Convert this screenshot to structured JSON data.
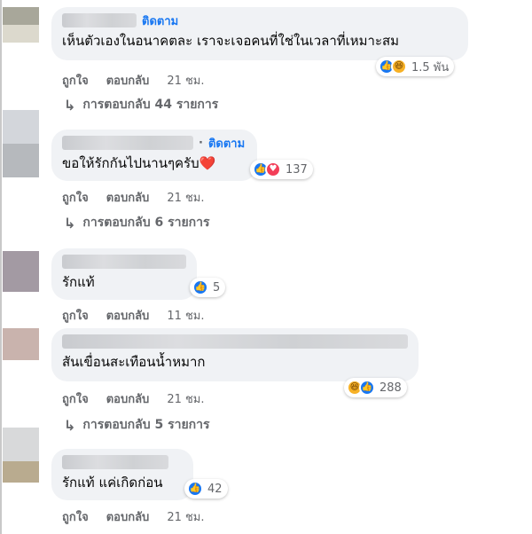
{
  "labels": {
    "follow": "ติดตาม",
    "like": "ถูกใจ",
    "reply": "ตอบกลับ"
  },
  "comments": [
    {
      "follow": true,
      "text": "เห็นตัวเองในอนาคตละ เราจะเจอคนที่ใช่ในเวลาที่เหมาะสม",
      "reactions": [
        "like-icon",
        "haha-icon"
      ],
      "count": "1.5 พัน",
      "time": "21 ชม.",
      "replies": "การตอบกลับ 44 รายการ",
      "avatar_colors": [
        "#a8a79a",
        "#dcd9cd"
      ]
    },
    {
      "follow": true,
      "text": "ขอให้รักกันไปนานๆครับ❤️",
      "reactions": [
        "like-icon",
        "love-icon"
      ],
      "count": "137",
      "time": "21 ชม.",
      "replies": "การตอบกลับ 6 รายการ",
      "avatar_colors": [
        "#c9ccd2",
        "#b6b9bd"
      ]
    },
    {
      "follow": false,
      "text": "รักแท้",
      "reactions": [
        "like-icon"
      ],
      "count": "5",
      "time": "11 ชม.",
      "replies": "",
      "avatar_colors": [
        "#a39aa3",
        "#d1c9d0"
      ]
    },
    {
      "follow": false,
      "text": "สันเขื่อนสะเทือนน้ำหมาก",
      "reactions": [
        "haha-icon",
        "like-icon"
      ],
      "count": "288",
      "time": "21 ชม.",
      "replies": "การตอบกลับ 5 รายการ",
      "avatar_colors": [
        "#c9b3ad",
        "#d8c9c4"
      ]
    },
    {
      "follow": false,
      "text": "รักแท้ แค่เกิดก่อน",
      "reactions": [
        "like-icon"
      ],
      "count": "42",
      "time": "21 ชม.",
      "replies": "",
      "avatar_colors": [
        "#c5c6c7",
        "#b9ab8f"
      ]
    }
  ]
}
